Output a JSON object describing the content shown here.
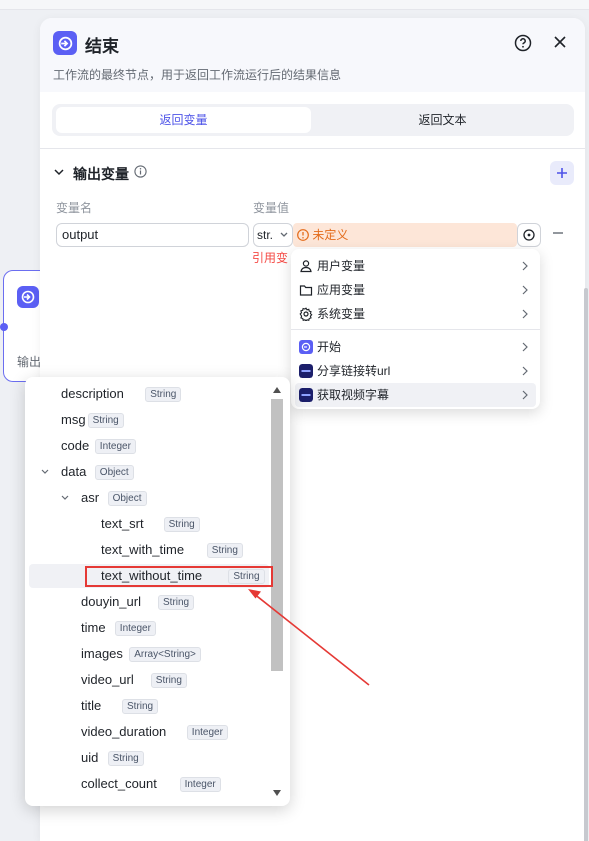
{
  "canvas_node": {
    "label": "输出"
  },
  "panel": {
    "title": "结束",
    "description": "工作流的最终节点，用于返回工作流运行后的结果信息",
    "tabs": [
      {
        "label": "返回变量",
        "active": true
      },
      {
        "label": "返回文本",
        "active": false
      }
    ]
  },
  "output_section": {
    "title": "输出变量",
    "col_name": "变量名",
    "col_value": "变量值",
    "row": {
      "name": "output",
      "type": "str.",
      "value": "未定义",
      "error": "引用变"
    }
  },
  "var_menu": {
    "items": [
      {
        "label": "用户变量",
        "icon": "user-icon"
      },
      {
        "label": "应用变量",
        "icon": "folder-icon"
      },
      {
        "label": "系统变量",
        "icon": "gear-icon"
      },
      {
        "label": "开始",
        "icon": "start-node-icon"
      },
      {
        "label": "分享链接转url",
        "icon": "plugin-icon"
      },
      {
        "label": "获取视频字幕",
        "icon": "plugin-icon"
      }
    ]
  },
  "tree": {
    "rows": [
      {
        "name": "description",
        "type": "String",
        "depth": 0,
        "expandable": false,
        "selected": false
      },
      {
        "name": "msg",
        "type": "String",
        "depth": 0,
        "expandable": false,
        "selected": false
      },
      {
        "name": "code",
        "type": "Integer",
        "depth": 0,
        "expandable": false,
        "selected": false
      },
      {
        "name": "data",
        "type": "Object",
        "depth": 0,
        "expandable": true,
        "selected": false
      },
      {
        "name": "asr",
        "type": "Object",
        "depth": 1,
        "expandable": true,
        "selected": false
      },
      {
        "name": "text_srt",
        "type": "String",
        "depth": 2,
        "expandable": false,
        "selected": false
      },
      {
        "name": "text_with_time",
        "type": "String",
        "depth": 2,
        "expandable": false,
        "selected": false
      },
      {
        "name": "text_without_time",
        "type": "String",
        "depth": 2,
        "expandable": false,
        "selected": true
      },
      {
        "name": "douyin_url",
        "type": "String",
        "depth": 1,
        "expandable": false,
        "selected": false
      },
      {
        "name": "time",
        "type": "Integer",
        "depth": 1,
        "expandable": false,
        "selected": false
      },
      {
        "name": "images",
        "type": "Array<String>",
        "depth": 1,
        "expandable": false,
        "selected": false
      },
      {
        "name": "video_url",
        "type": "String",
        "depth": 1,
        "expandable": false,
        "selected": false
      },
      {
        "name": "title",
        "type": "String",
        "depth": 1,
        "expandable": false,
        "selected": false
      },
      {
        "name": "video_duration",
        "type": "Integer",
        "depth": 1,
        "expandable": false,
        "selected": false
      },
      {
        "name": "uid",
        "type": "String",
        "depth": 1,
        "expandable": false,
        "selected": false
      },
      {
        "name": "collect_count",
        "type": "Integer",
        "depth": 1,
        "expandable": false,
        "selected": false
      }
    ]
  },
  "colors": {
    "accent": "#4d53e8",
    "node_icon": "#5b5ff4",
    "warning": "#e36b1a",
    "error": "#f54a45",
    "annotation": "#e53935"
  }
}
